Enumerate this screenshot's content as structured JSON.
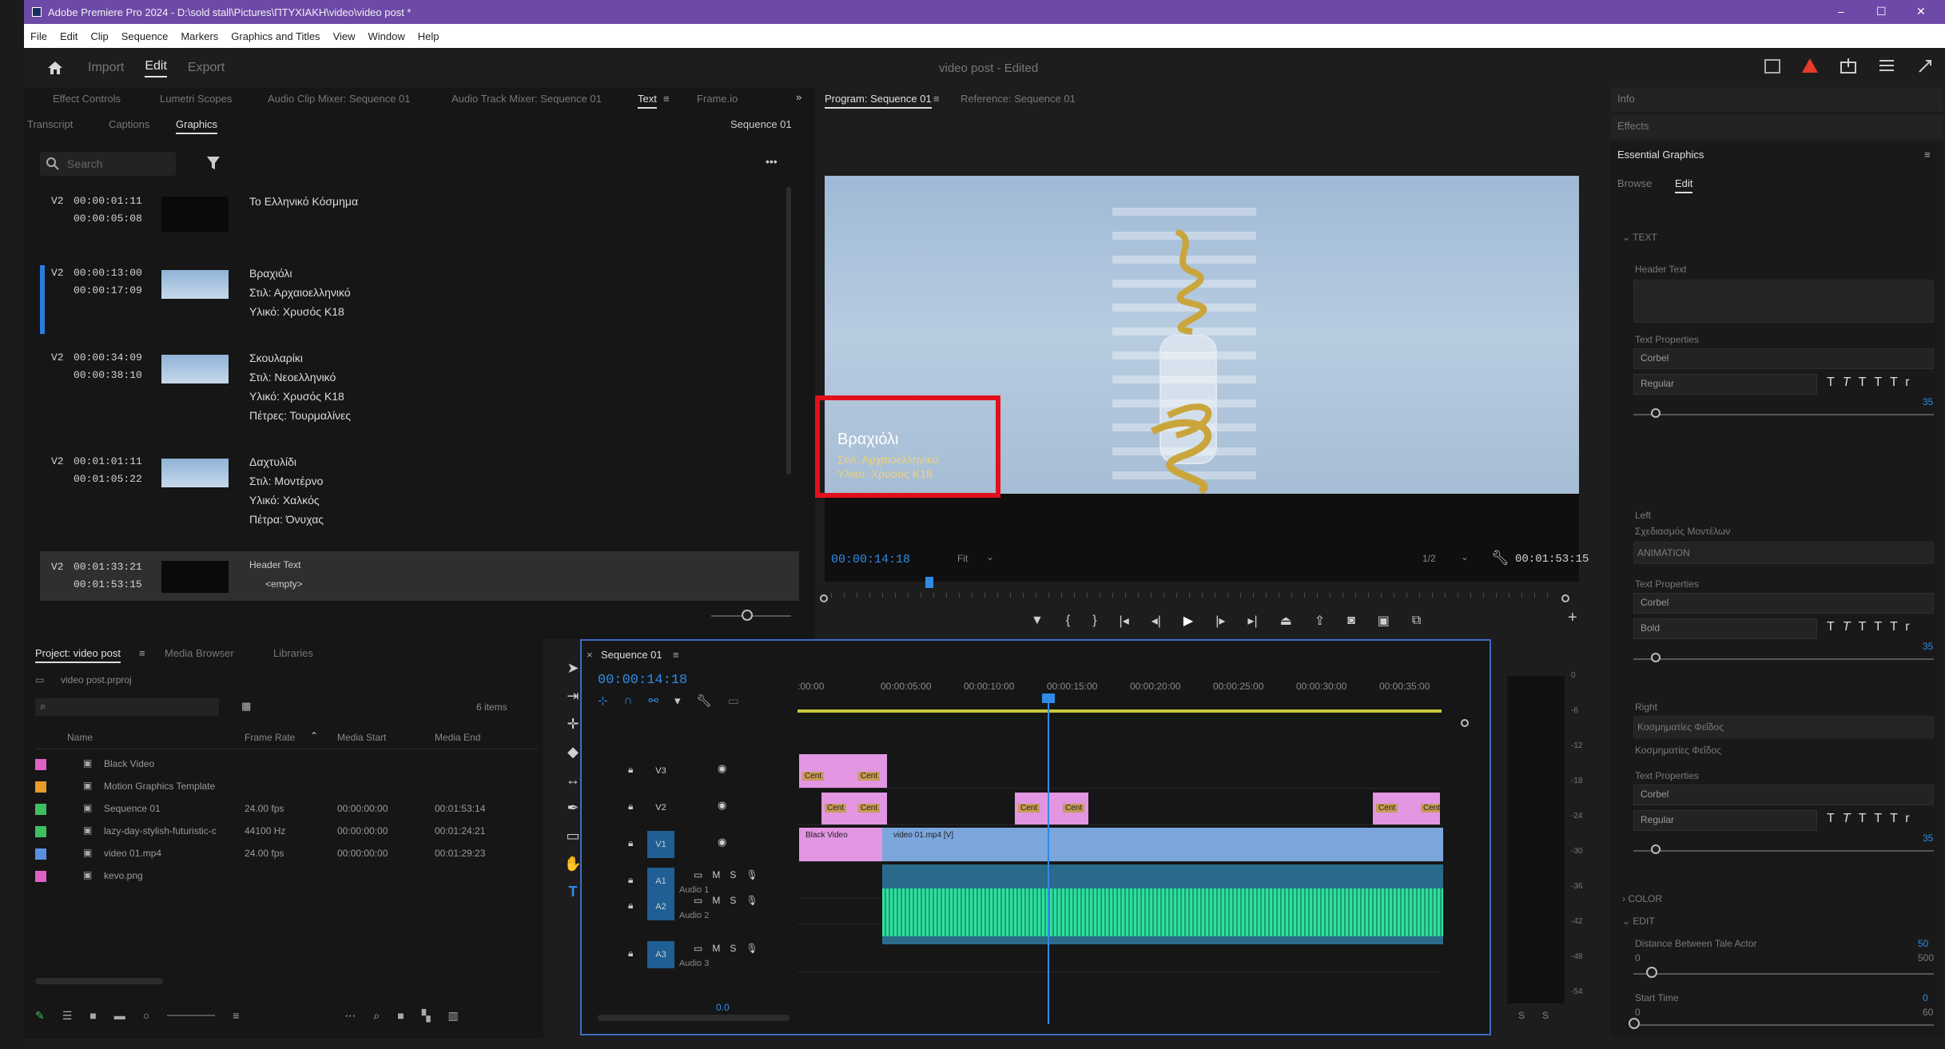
{
  "app": {
    "title": "Adobe Premiere Pro 2024 - D:\\sold stall\\Pictures\\ΠΤΥΧΙΑΚΗ\\video\\video post *",
    "window_controls": [
      "–",
      "☐",
      "✕"
    ]
  },
  "menu": [
    "File",
    "Edit",
    "Clip",
    "Sequence",
    "Markers",
    "Graphics and Titles",
    "View",
    "Window",
    "Help"
  ],
  "header": {
    "home_icon": "home-icon",
    "tabs": [
      "Import",
      "Edit",
      "Export"
    ],
    "active_tab": "Edit",
    "project_title": "video post - Edited"
  },
  "source_panel": {
    "tabs": [
      "Effect Controls",
      "Lumetri Scopes",
      "Audio Clip Mixer: Sequence 01",
      "Audio Track Mixer: Sequence 01",
      "Text",
      "Frame.io"
    ],
    "active_tab": "Text",
    "subtabs": [
      "Transcript",
      "Captions",
      "Graphics"
    ],
    "active_subtab": "Graphics",
    "sequence_label": "Sequence 01",
    "search_placeholder": "Search",
    "more": "•••",
    "items": [
      {
        "track": "V2",
        "tc_in": "00:00:01:11",
        "tc_out": "00:00:05:08",
        "lines": [
          "Το Ελληνικό Κόσμημα"
        ]
      },
      {
        "track": "V2",
        "tc_in": "00:00:13:00",
        "tc_out": "00:00:17:09",
        "lines": [
          "Βραχιόλι",
          "Στιλ: Αρχαιοελληνικό",
          "Υλικό: Χρυσός Κ18"
        ]
      },
      {
        "track": "V2",
        "tc_in": "00:00:34:09",
        "tc_out": "00:00:38:10",
        "lines": [
          "Σκουλαρίκι",
          "Στιλ: Νεοελληνικό",
          "Υλικό: Χρυσός Κ18",
          "Πέτρες: Τουρμαλίνες"
        ]
      },
      {
        "track": "V2",
        "tc_in": "00:01:01:11",
        "tc_out": "00:01:05:22",
        "lines": [
          "Δαχτυλίδι",
          "Στιλ: Μοντέρνο",
          "Υλικό: Χαλκός",
          "Πέτρα: Όνυχας"
        ]
      },
      {
        "track": "V2",
        "tc_in": "00:01:33:21",
        "tc_out": "00:01:53:15",
        "lines": [
          "Header Text",
          "<empty>"
        ]
      }
    ]
  },
  "program_monitor": {
    "tabs": [
      "Program: Sequence 01",
      "Reference: Sequence 01"
    ],
    "overlay": {
      "title": "Βραχιόλι",
      "line1": "Στιλ: Αρχαιοελληνικό",
      "line2": "Υλικό: Χρυσός Κ18"
    },
    "timecode": "00:00:14:18",
    "fit": "Fit",
    "resolution": "1/2",
    "duration": "00:01:53:15",
    "playhead_fraction": 0.13
  },
  "project_panel": {
    "tabs": [
      "Project: video post",
      "Media Browser",
      "Libraries"
    ],
    "project_file": "video post.prproj",
    "item_count": "6 items",
    "columns": [
      "Name",
      "Frame Rate",
      "Media Start",
      "Media End"
    ],
    "rows": [
      {
        "color": "#e060c8",
        "name": "Black Video",
        "fps": "",
        "start": "",
        "end": ""
      },
      {
        "color": "#e89a2a",
        "name": "Motion Graphics Template",
        "fps": "",
        "start": "",
        "end": ""
      },
      {
        "color": "#3fc060",
        "name": "Sequence 01",
        "fps": "24.00 fps",
        "start": "00:00:00:00",
        "end": "00:01:53:14"
      },
      {
        "color": "#3fc060",
        "name": "lazy-day-stylish-futuristic-c",
        "fps": "44100 Hz",
        "start": "00:00:00:00",
        "end": "00:01:24:21"
      },
      {
        "color": "#5a8fe0",
        "name": "video 01.mp4",
        "fps": "24.00 fps",
        "start": "00:00:00:00",
        "end": "00:01:29:23"
      },
      {
        "color": "#e060c8",
        "name": "kevo.png",
        "fps": "",
        "start": "",
        "end": ""
      }
    ]
  },
  "timeline": {
    "tab": "Sequence 01",
    "timecode": "00:00:14:18",
    "ruler": [
      ":00:00",
      "00:00:05:00",
      "00:00:10:00",
      "00:00:15:00",
      "00:00:20:00",
      "00:00:25:00",
      "00:00:30:00",
      "00:00:35:00"
    ],
    "tracks": [
      "V3",
      "V2",
      "V1",
      "A1",
      "A2",
      "A3"
    ],
    "track_names": {
      "a1": "Audio 1",
      "a2": "Audio 2",
      "a3": "Audio 3"
    },
    "v1_clips": {
      "black": "Black Video",
      "video": "video 01.mp4 [V]"
    },
    "small_clip_label": "Cent",
    "audio_db": "0.0",
    "meter_ticks": [
      "0",
      "-6",
      "-12",
      "-18",
      "-24",
      "-30",
      "-36",
      "-42",
      "-48",
      "-54"
    ],
    "meter_labels": [
      "S",
      "S"
    ]
  },
  "right_panel": {
    "tabs": [
      "Info",
      "Effects",
      "Essential Graphics"
    ],
    "eg_subtabs": [
      "Browse",
      "Edit"
    ],
    "active_subtab": "Edit",
    "sections": {
      "text": "TEXT",
      "header_text": "Header Text",
      "text_properties": "Text Properties",
      "font1": "Corbel",
      "style1": "Regular",
      "size1": "35",
      "left": "Left",
      "left_value": "Σχεδιασμός Μοντέλων",
      "animation": "ANIMATION",
      "font2": "Corbel",
      "style2": "Bold",
      "size2": "35",
      "right": "Right",
      "right1": "Κοσμηματίες Φεΐδος",
      "right2": "Κοσμηματίες Φεΐδος",
      "font3": "Corbel",
      "style3": "Regular",
      "size3": "35",
      "color": "COLOR",
      "edit": "EDIT",
      "distance": "Distance Between Tale Actor",
      "distance_min": "0",
      "distance_val": "50",
      "distance_max": "500",
      "start_time": "Start Time",
      "start_min": "0",
      "start_val": "0",
      "start_max": "60"
    }
  }
}
